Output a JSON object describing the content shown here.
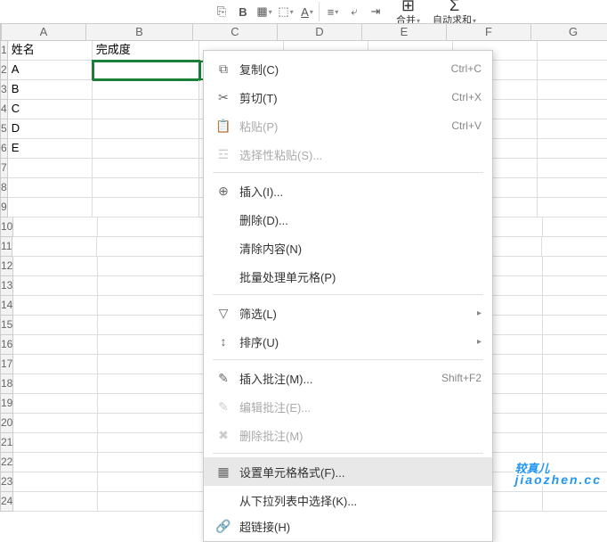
{
  "toolbar": {
    "merge_label": "合并",
    "autosum_label": "自动求和"
  },
  "columns": [
    "A",
    "B",
    "C",
    "D",
    "E",
    "F",
    "G"
  ],
  "headers": {
    "col_a": "姓名",
    "col_b": "完成度"
  },
  "rows": [
    {
      "n": "1",
      "a": "姓名",
      "b": "完成度"
    },
    {
      "n": "2",
      "a": "A",
      "b": ""
    },
    {
      "n": "3",
      "a": "B",
      "b": ""
    },
    {
      "n": "4",
      "a": "C",
      "b": ""
    },
    {
      "n": "5",
      "a": "D",
      "b": ""
    },
    {
      "n": "6",
      "a": "E",
      "b": ""
    },
    {
      "n": "7",
      "a": "",
      "b": ""
    },
    {
      "n": "8",
      "a": "",
      "b": ""
    },
    {
      "n": "9",
      "a": "",
      "b": ""
    },
    {
      "n": "10",
      "a": "",
      "b": ""
    },
    {
      "n": "11",
      "a": "",
      "b": ""
    },
    {
      "n": "12",
      "a": "",
      "b": ""
    },
    {
      "n": "13",
      "a": "",
      "b": ""
    },
    {
      "n": "14",
      "a": "",
      "b": ""
    },
    {
      "n": "15",
      "a": "",
      "b": ""
    },
    {
      "n": "16",
      "a": "",
      "b": ""
    },
    {
      "n": "17",
      "a": "",
      "b": ""
    },
    {
      "n": "18",
      "a": "",
      "b": ""
    },
    {
      "n": "19",
      "a": "",
      "b": ""
    },
    {
      "n": "20",
      "a": "",
      "b": ""
    },
    {
      "n": "21",
      "a": "",
      "b": ""
    },
    {
      "n": "22",
      "a": "",
      "b": ""
    },
    {
      "n": "23",
      "a": "",
      "b": ""
    },
    {
      "n": "24",
      "a": "",
      "b": ""
    }
  ],
  "context_menu": {
    "copy": {
      "label": "复制(C)",
      "shortcut": "Ctrl+C"
    },
    "cut": {
      "label": "剪切(T)",
      "shortcut": "Ctrl+X"
    },
    "paste": {
      "label": "粘贴(P)",
      "shortcut": "Ctrl+V"
    },
    "paste_spec": {
      "label": "选择性粘贴(S)..."
    },
    "insert": {
      "label": "插入(I)..."
    },
    "delete": {
      "label": "删除(D)..."
    },
    "clear": {
      "label": "清除内容(N)"
    },
    "batch": {
      "label": "批量处理单元格(P)"
    },
    "filter": {
      "label": "筛选(L)"
    },
    "sort": {
      "label": "排序(U)"
    },
    "ins_comment": {
      "label": "插入批注(M)...",
      "shortcut": "Shift+F2"
    },
    "edit_comment": {
      "label": "编辑批注(E)..."
    },
    "del_comment": {
      "label": "删除批注(M)"
    },
    "format": {
      "label": "设置单元格格式(F)..."
    },
    "dropdown": {
      "label": "从下拉列表中选择(K)..."
    },
    "hyperlink": {
      "label": "超链接(H)"
    }
  },
  "watermark": {
    "main": "较真儿",
    "sub": "jiaozhen.cc"
  }
}
